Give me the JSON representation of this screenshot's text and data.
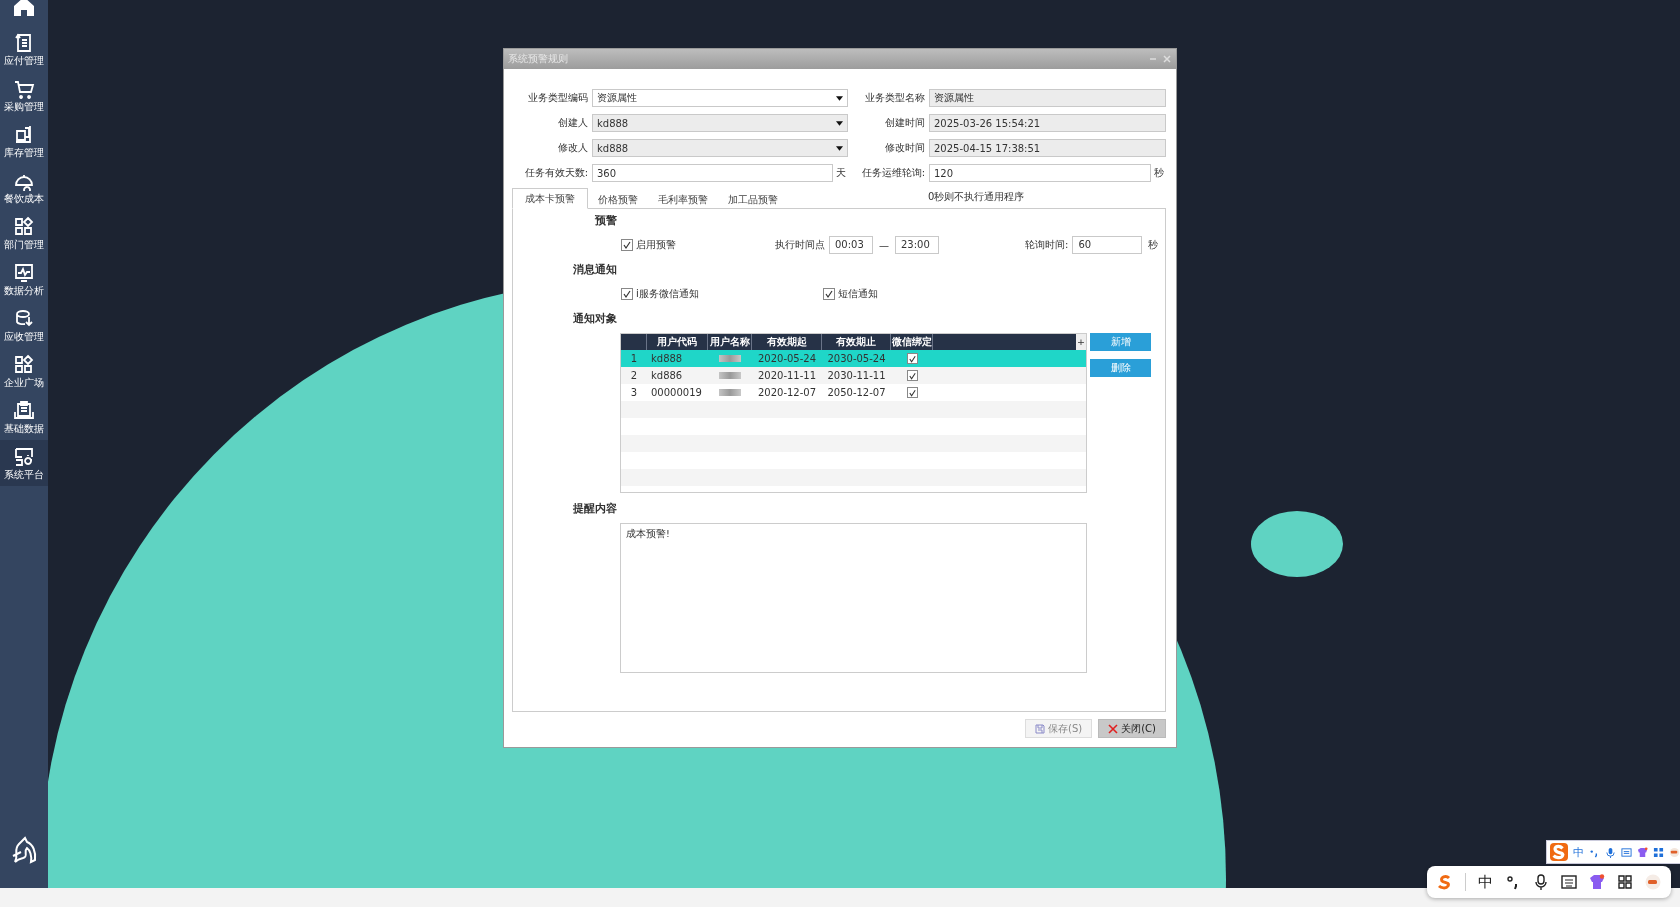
{
  "sidebar": {
    "items": [
      {
        "label": "应付管理",
        "selected": false
      },
      {
        "label": "采购管理",
        "selected": false
      },
      {
        "label": "库存管理",
        "selected": false
      },
      {
        "label": "餐饮成本",
        "selected": false
      },
      {
        "label": "部门管理",
        "selected": false
      },
      {
        "label": "数据分析",
        "selected": false
      },
      {
        "label": "应收管理",
        "selected": false
      },
      {
        "label": "企业广场",
        "selected": false
      },
      {
        "label": "基础数据",
        "selected": false
      },
      {
        "label": "系统平台",
        "selected": true
      }
    ]
  },
  "dialog": {
    "title": "系统预警规则",
    "fields": [
      {
        "label": "业务类型编码",
        "value": "资源属性",
        "kind": "select",
        "disabled": false
      },
      {
        "label": "业务类型名称",
        "value": "资源属性",
        "kind": "text",
        "disabled": true
      },
      {
        "label": "创建人",
        "value": "kd888",
        "kind": "select",
        "disabled": true
      },
      {
        "label": "创建时间",
        "value": "2025-03-26 15:54:21",
        "kind": "text",
        "disabled": true
      },
      {
        "label": "修改人",
        "value": "kd888",
        "kind": "select",
        "disabled": true
      },
      {
        "label": "修改时间",
        "value": "2025-04-15 17:38:51",
        "kind": "text",
        "disabled": true
      },
      {
        "label": "任务有效天数:",
        "value": "360",
        "kind": "text",
        "disabled": false,
        "unit": "天"
      },
      {
        "label": "任务运维轮询:",
        "value": "120",
        "kind": "text",
        "disabled": false,
        "unit": "秒"
      }
    ],
    "note": "0秒则不执行通用程序",
    "tabs": [
      {
        "label": "成本卡预警",
        "selected": true
      },
      {
        "label": "价格预警",
        "selected": false
      },
      {
        "label": "毛利率预警",
        "selected": false
      },
      {
        "label": "加工品预警",
        "selected": false
      }
    ],
    "alert": {
      "heading": "预警",
      "enable": {
        "label": "启用预警",
        "checked": true
      },
      "time_label": "执行时间点",
      "time_from": "00:03",
      "time_separator": "—",
      "time_to": "23:00",
      "poll_label": "轮询时间:",
      "poll_value": "60",
      "poll_unit": "秒"
    },
    "notify": {
      "heading": "消息通知",
      "options": [
        {
          "label": "i服务微信通知",
          "checked": true
        },
        {
          "label": "短信通知",
          "checked": true
        }
      ]
    },
    "targets": {
      "heading": "通知对象",
      "columns": [
        "用户代码",
        "用户名称",
        "有效期起",
        "有效期止",
        "微信绑定"
      ],
      "add_column": "+",
      "rows": [
        {
          "index": "1",
          "code": "kd888",
          "from": "2020-05-24",
          "to": "2030-05-24",
          "wechat_bound": true,
          "selected": true
        },
        {
          "index": "2",
          "code": "kd886",
          "from": "2020-11-11",
          "to": "2030-11-11",
          "wechat_bound": true,
          "selected": false
        },
        {
          "index": "3",
          "code": "00000019",
          "from": "2020-12-07",
          "to": "2050-12-07",
          "wechat_bound": true,
          "selected": false
        }
      ],
      "add_button": "新增",
      "delete_button": "删除"
    },
    "reminder": {
      "heading": "提醒内容",
      "text": "成本预警!"
    },
    "buttons": [
      {
        "label": "保存(S)",
        "kind": "save"
      },
      {
        "label": "关闭(C)",
        "kind": "close"
      }
    ]
  },
  "ime": {
    "small_lang": "中",
    "large_lang": "中"
  }
}
